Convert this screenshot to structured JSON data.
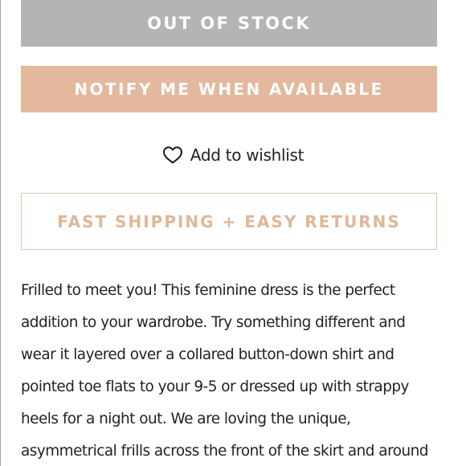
{
  "buttons": {
    "out_of_stock": "OUT OF STOCK",
    "notify": "NOTIFY ME WHEN AVAILABLE"
  },
  "wishlist": {
    "label": "Add to wishlist",
    "icon": "heart-outline-icon"
  },
  "shipping_banner": "FAST SHIPPING + EASY RETURNS",
  "description": {
    "lines": [
      "Frilled to meet you! This feminine dress is the perfect",
      "addition to your wardrobe. Try something different and",
      "wear it layered over a collared button-down shirt and",
      "pointed toe flats to your 9-5 or dressed up with strappy",
      "heels for a night out. We are loving the unique,",
      "asymmetrical frills across the front of the skirt and around"
    ]
  },
  "colors": {
    "out_of_stock_bg": "#b4b4b4",
    "notify_bg": "#e3b89d",
    "shipping_border": "#e3c3ad",
    "shipping_text": "#e0b797",
    "body_text": "#222222"
  }
}
